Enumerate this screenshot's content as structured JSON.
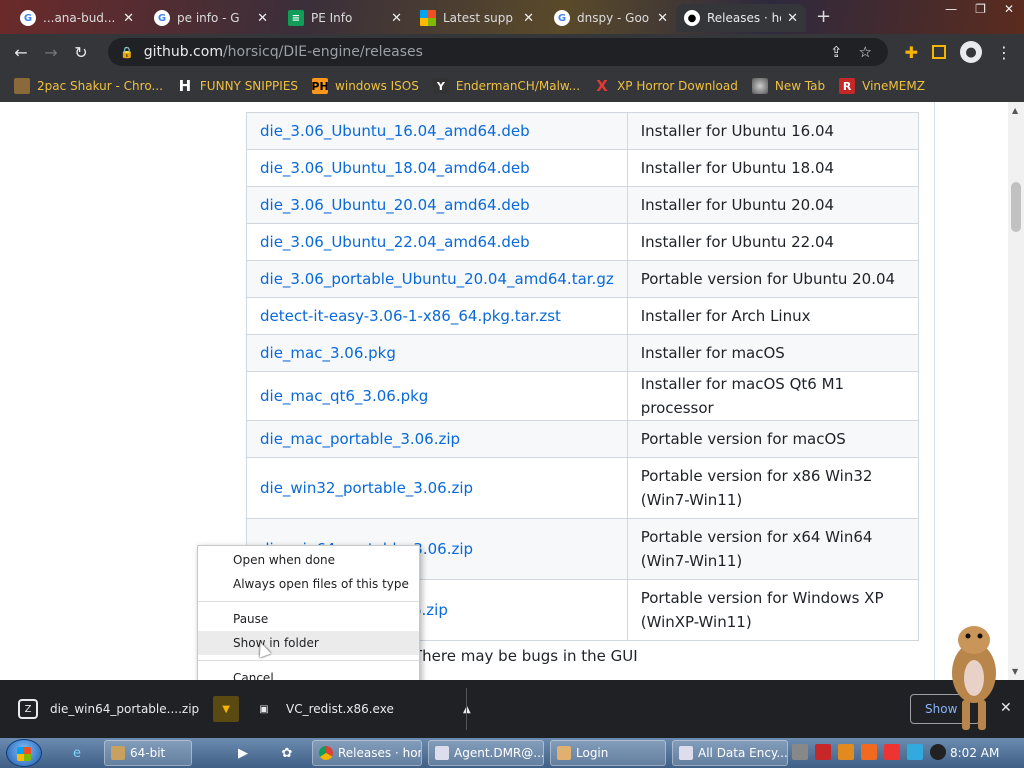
{
  "tabs": [
    {
      "title": "...ana-bud...",
      "icon": "google"
    },
    {
      "title": "pe info - G",
      "icon": "google"
    },
    {
      "title": "PE Info",
      "icon": "sheets"
    },
    {
      "title": "Latest supp",
      "icon": "microsoft"
    },
    {
      "title": "dnspy - Goo",
      "icon": "google"
    },
    {
      "title": "Releases · ho",
      "icon": "github",
      "active": true
    }
  ],
  "address": {
    "host": "github.com",
    "path": "/horsicq/DIE-engine/releases"
  },
  "bookmarks": [
    {
      "label": "2pac Shakur - Chro..."
    },
    {
      "label": "FUNNY SNIPPIES"
    },
    {
      "label": "windows ISOS"
    },
    {
      "label": "EndermanCH/Malw..."
    },
    {
      "label": "XP Horror Download"
    },
    {
      "label": "New Tab"
    },
    {
      "label": "VineMEMZ"
    }
  ],
  "assets": [
    {
      "file": "die_3.06_Ubuntu_16.04_amd64.deb",
      "desc": "Installer for Ubuntu 16.04"
    },
    {
      "file": "die_3.06_Ubuntu_18.04_amd64.deb",
      "desc": "Installer for Ubuntu 18.04"
    },
    {
      "file": "die_3.06_Ubuntu_20.04_amd64.deb",
      "desc": "Installer for Ubuntu 20.04"
    },
    {
      "file": "die_3.06_Ubuntu_22.04_amd64.deb",
      "desc": "Installer for Ubuntu 22.04"
    },
    {
      "file": "die_3.06_portable_Ubuntu_20.04_amd64.tar.gz",
      "desc": "Portable version for Ubuntu 20.04"
    },
    {
      "file": "detect-it-easy-3.06-1-x86_64.pkg.tar.zst",
      "desc": "Installer for Arch Linux"
    },
    {
      "file": "die_mac_3.06.pkg",
      "desc": "Installer for macOS"
    },
    {
      "file": "die_mac_qt6_3.06.pkg",
      "desc": "Installer for macOS Qt6 M1 processor"
    },
    {
      "file": "die_mac_portable_3.06.zip",
      "desc": "Portable version for macOS"
    },
    {
      "file": "die_win32_portable_3.06.zip",
      "desc": "Portable version for x86 Win32 (Win7-Win11)"
    },
    {
      "file": "die_win64_portable_3.06.zip",
      "desc": "Portable version for x64 Win64 (Win7-Win11)"
    },
    {
      "file": "6.zip",
      "desc": "Portable version for Windows XP (WinXP-Win11)"
    }
  ],
  "note": "There may be bugs in the GUI",
  "context_menu": {
    "open_when_done": "Open when done",
    "always_open": "Always open files of this type",
    "pause": "Pause",
    "show_in_folder": "Show in folder",
    "cancel": "Cancel"
  },
  "downloads": [
    {
      "name": "die_win64_portable....zip"
    },
    {
      "name": "VC_redist.x86.exe"
    }
  ],
  "show_all_label": "Show",
  "taskbar": {
    "tasks": [
      "64-bit",
      "Releases · hor...",
      "Agent.DMR@...",
      "Login",
      "All Data Ency..."
    ],
    "clock": "8:02 AM"
  }
}
